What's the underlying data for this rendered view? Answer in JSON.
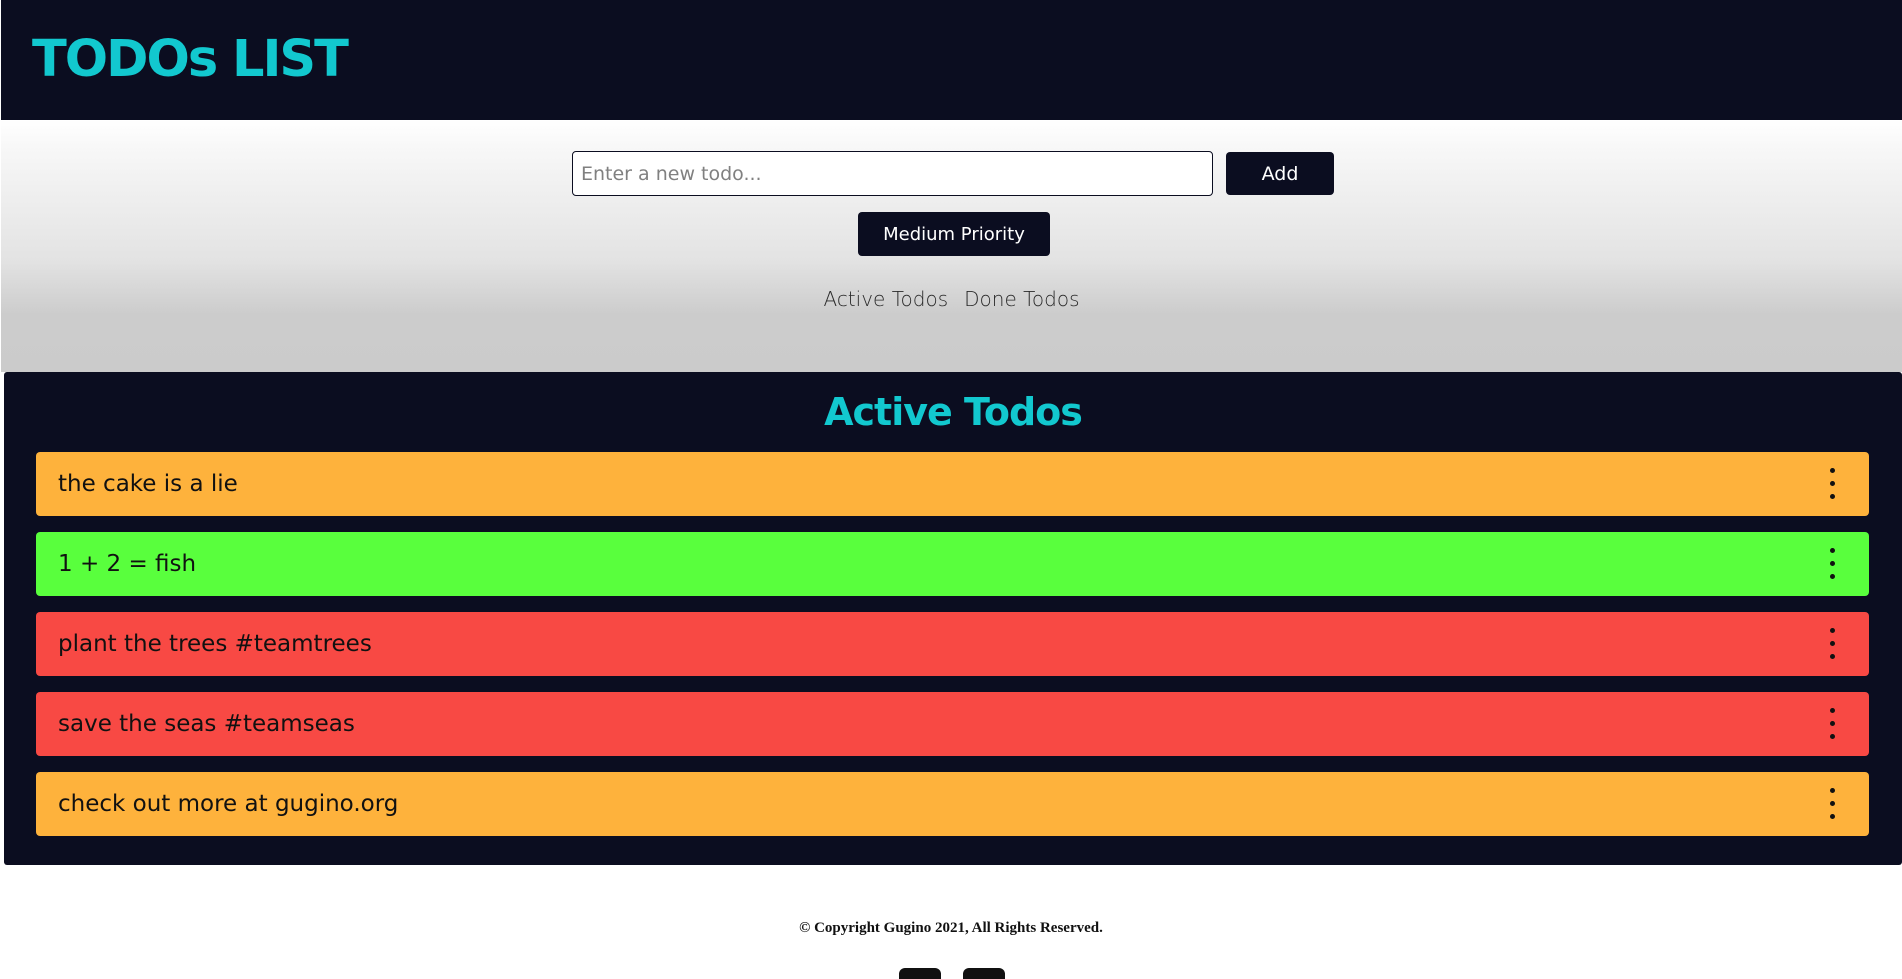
{
  "header": {
    "title": "TODOs LIST"
  },
  "form": {
    "placeholder": "Enter a new todo...",
    "add_label": "Add",
    "priority_label": "Medium Priority"
  },
  "tabs": [
    {
      "label": "Active Todos"
    },
    {
      "label": "Done Todos"
    }
  ],
  "list": {
    "title": "Active Todos",
    "items": [
      {
        "text": "the cake is a lie",
        "priority": "medium",
        "color": "#feb23c"
      },
      {
        "text": "1 + 2 = fish",
        "priority": "low",
        "color": "#59ff3d"
      },
      {
        "text": "plant the trees #teamtrees",
        "priority": "high",
        "color": "#f84944"
      },
      {
        "text": "save the seas #teamseas",
        "priority": "high",
        "color": "#f84944"
      },
      {
        "text": "check out more at gugino.org",
        "priority": "medium",
        "color": "#feb23c"
      }
    ]
  },
  "footer": {
    "copyright": "© Copyright Gugino 2021, All Rights Reserved.",
    "social_icons": [
      "facebook-icon",
      "social-icon"
    ]
  },
  "colors": {
    "header_bg": "#0b0d20",
    "accent": "#12c8cf"
  }
}
